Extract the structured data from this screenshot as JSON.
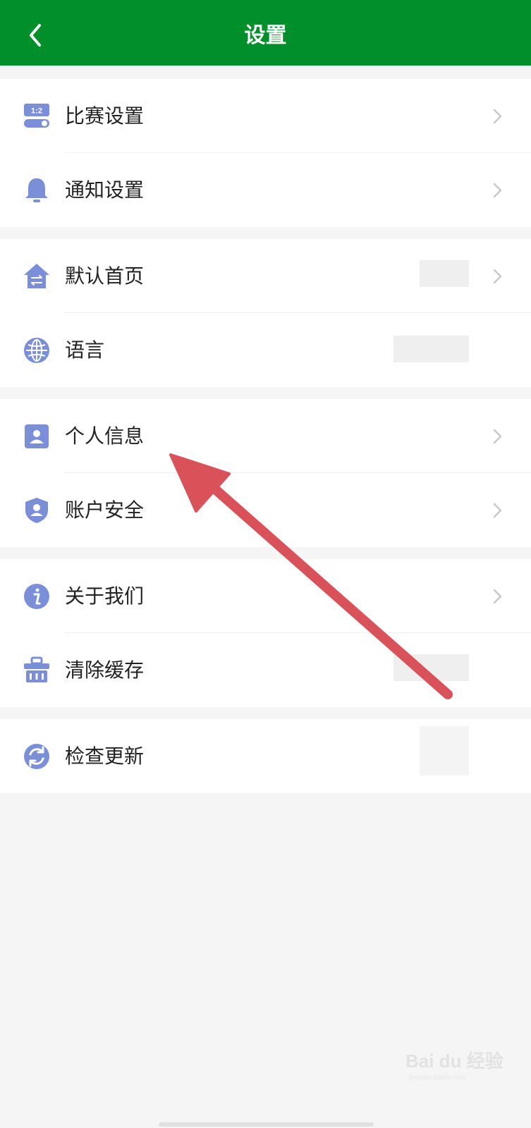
{
  "header": {
    "title": "设置"
  },
  "groups": [
    {
      "items": [
        {
          "label": "比赛设置"
        },
        {
          "label": "通知设置"
        }
      ]
    },
    {
      "items": [
        {
          "label": "默认首页"
        },
        {
          "label": "语言"
        }
      ]
    },
    {
      "items": [
        {
          "label": "个人信息"
        },
        {
          "label": "账户安全"
        }
      ]
    },
    {
      "items": [
        {
          "label": "关于我们"
        },
        {
          "label": "清除缓存"
        }
      ]
    },
    {
      "items": [
        {
          "label": "检查更新"
        }
      ]
    }
  ],
  "icons": {
    "match_settings": "scoreboard-toggle-icon",
    "notification": "bell-icon",
    "default_home": "home-switch-icon",
    "language": "globe-icon",
    "personal_info": "person-card-icon",
    "account_security": "shield-user-icon",
    "about": "info-icon",
    "clear_cache": "basket-icon",
    "check_update": "refresh-icon"
  },
  "watermark": {
    "brand": "Bai du 经验",
    "url": "jingyan.baidu.com"
  },
  "colors": {
    "header_bg": "#008f2a",
    "icon": "#7b8fd8",
    "arrow": "#d9525a",
    "chevron": "#c8c8c8"
  }
}
